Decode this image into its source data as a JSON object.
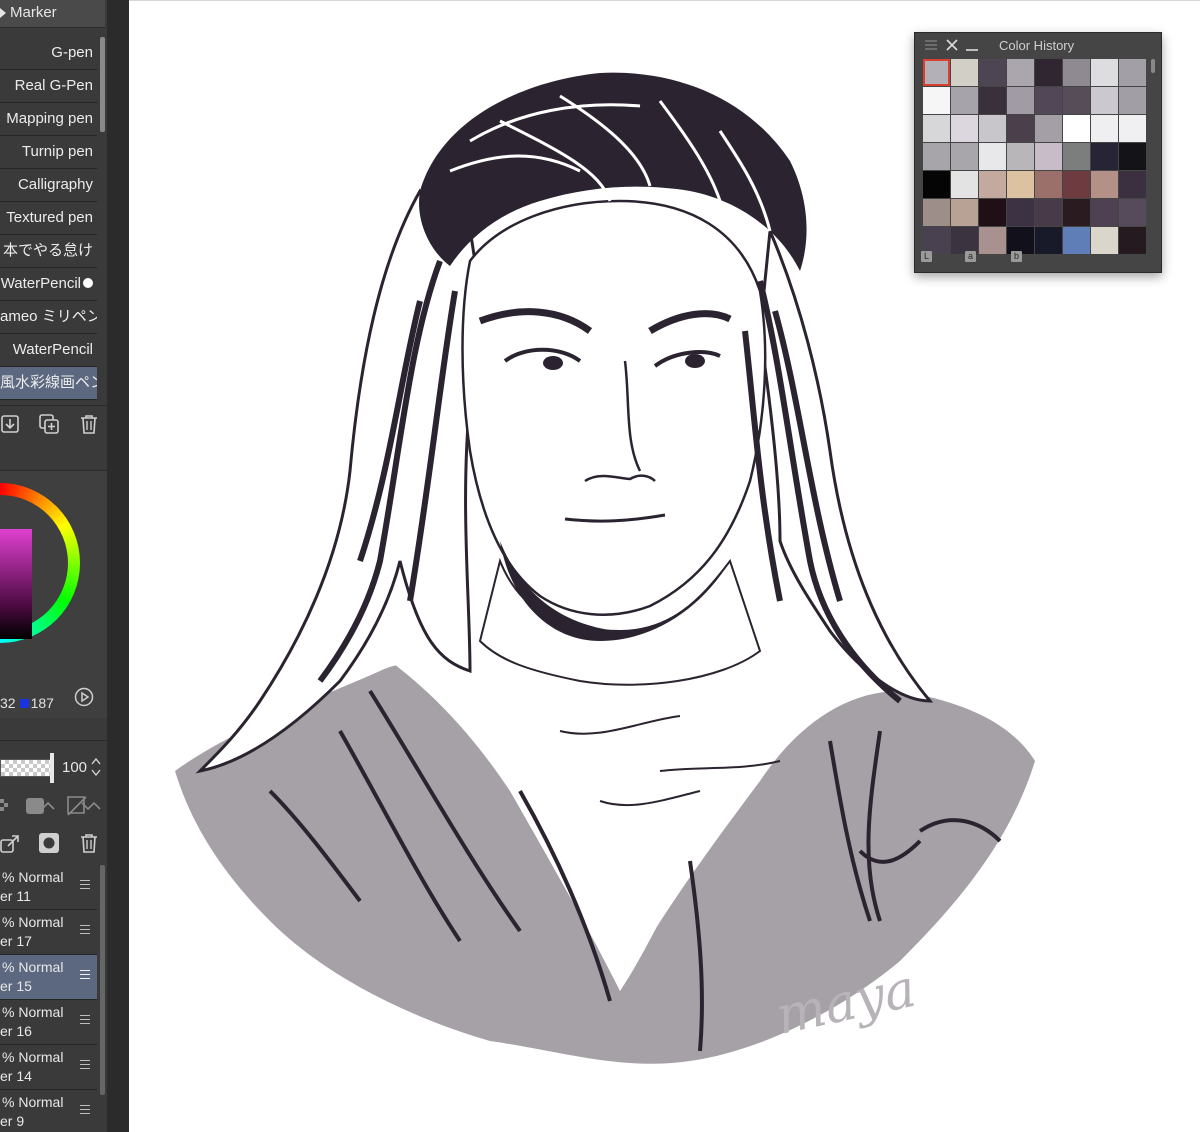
{
  "brush_panel": {
    "group_label": "Marker",
    "items": [
      {
        "label": "G-pen",
        "selected": false
      },
      {
        "label": "Real G-Pen",
        "selected": false
      },
      {
        "label": "Mapping pen",
        "selected": false
      },
      {
        "label": "Turnip pen",
        "selected": false
      },
      {
        "label": "Calligraphy",
        "selected": false
      },
      {
        "label": "Textured pen",
        "selected": false
      },
      {
        "label": "本でやる怠け",
        "selected": false
      },
      {
        "label": "WaterPencil",
        "selected": false
      },
      {
        "label": "ameo ミリペン",
        "selected": false
      },
      {
        "label": "WaterPencil",
        "selected": false
      },
      {
        "label": "風水彩線画ペン",
        "selected": true
      }
    ],
    "actions": [
      "download-icon",
      "duplicate-icon",
      "trash-icon"
    ]
  },
  "color_panel": {
    "rgb_partial": "32",
    "blue_value": "187",
    "accent_hue": "#e040d0",
    "blue_swatch_color": "#1a35e0"
  },
  "layer_panel": {
    "opacity": "100",
    "tool_icons": [
      "checker-icon",
      "lock-transparency-icon",
      "clip-icon",
      "copy-layer-icon",
      "mask-icon",
      "trash-icon"
    ],
    "layers": [
      {
        "mode": "% Normal",
        "name": "er 11",
        "selected": false
      },
      {
        "mode": "% Normal",
        "name": "er 17",
        "selected": false
      },
      {
        "mode": "% Normal",
        "name": "er 15",
        "selected": true
      },
      {
        "mode": "% Normal",
        "name": "er 16",
        "selected": false
      },
      {
        "mode": "% Normal",
        "name": "er 14",
        "selected": false
      },
      {
        "mode": "% Normal",
        "name": "er 9",
        "selected": false
      }
    ]
  },
  "color_history": {
    "title": "Color History",
    "footer_labels": [
      "L",
      "a",
      "b"
    ],
    "swatches": [
      [
        "#b3b0b7",
        "#d2d0c6",
        "#4e4552",
        "#aaa6ad",
        "#2f2631",
        "#8f8992",
        "#dddde0",
        "#a39fa7"
      ],
      [
        "#f6f6f7",
        "#a7a3ab",
        "#3a303c",
        "#a09ba5",
        "#514756",
        "#574d58",
        "#cbc8cf",
        "#a29ea6"
      ],
      [
        "#d7d6d9",
        "#dcd7de",
        "#c8c6ca",
        "#4a3f4b",
        "#a49fa6",
        "#ffffff",
        "#efeff1",
        "#f0f0f2"
      ],
      [
        "#a7a5aa",
        "#a9a6ab",
        "#e8e8ea",
        "#b8b6b9",
        "#c7bcc7",
        "#7b7e7c",
        "#262435",
        "#141418"
      ],
      [
        "#050506",
        "#e3e3e3",
        "#c3a99e",
        "#dcc2a0",
        "#9b6f6a",
        "#6e3c40",
        "#b49187",
        "#3a3040"
      ],
      [
        "#9e8e89",
        "#b8a295",
        "#200f14",
        "#3d3243",
        "#483a49",
        "#2a1b21",
        "#4e4252",
        "#564b5a"
      ],
      [
        "#494050",
        "#3c3340",
        "#a9918f",
        "#12101a",
        "#181a2a",
        "#5f7eb8",
        "#dad6cb",
        "#241a20"
      ]
    ]
  },
  "canvas": {
    "signature_text": "maya"
  }
}
